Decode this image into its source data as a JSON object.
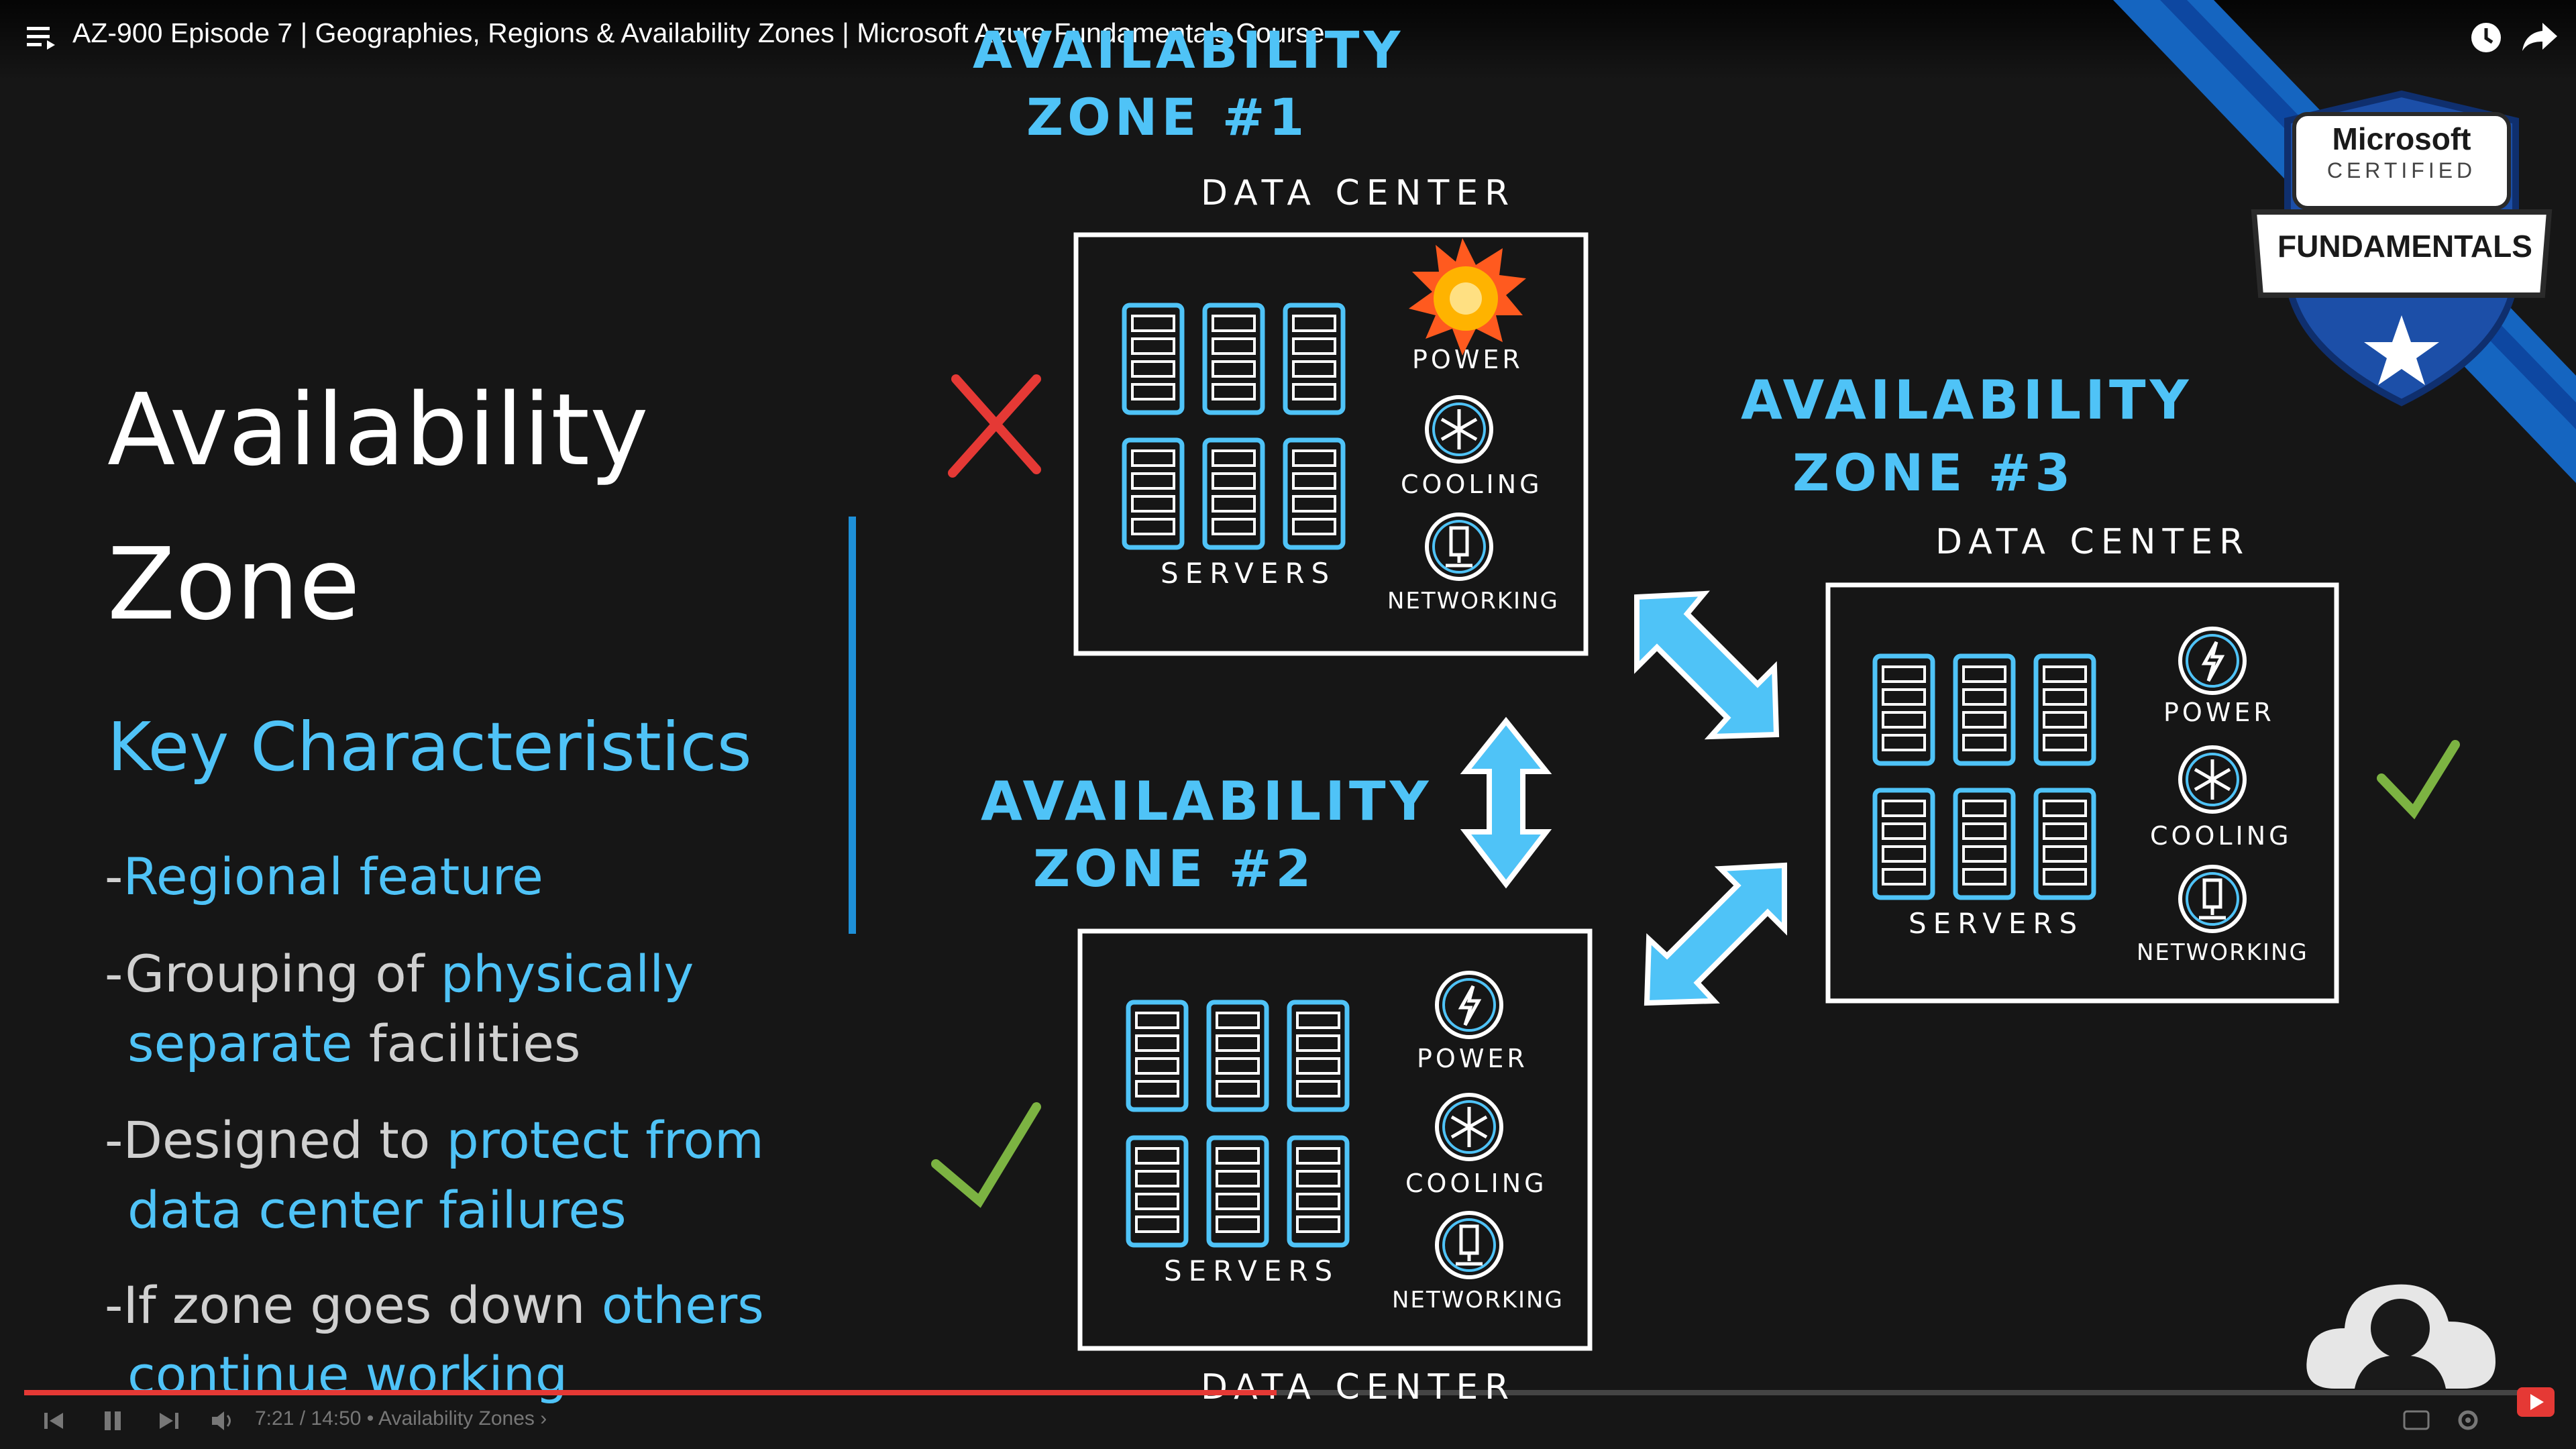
{
  "video": {
    "title": "AZ-900 Episode 7 | Geographies, Regions & Availability Zones | Microsoft Azure Fundamentals Course"
  },
  "badge": {
    "brand": "Microsoft",
    "certified": "CERTIFIED",
    "level": "FUNDAMENTALS"
  },
  "slide": {
    "heading_line1": "Availability",
    "heading_line2": "Zone",
    "subheading": "Key Characteristics",
    "bullets": [
      {
        "dash": "-",
        "parts": [
          "Regional feature"
        ]
      },
      {
        "dash": "-",
        "line1_plain": "Grouping of ",
        "line1_hl": "physically",
        "line2_hl": "separate",
        "line2_plain": " facilities"
      },
      {
        "dash": "-",
        "line1_plain": "Designed to ",
        "line1_hl": "protect from",
        "line2_hl": "data center failures"
      },
      {
        "dash": "-",
        "line1_plain": "If zone goes down ",
        "line1_hl": "others",
        "line2_hl": "continue working"
      }
    ]
  },
  "diagram": {
    "zone1_top": "AVAILABILITY",
    "zone1_bottom": "ZONE  #1",
    "zone2_top": "AVAILABILITY",
    "zone2_bottom": "ZONE  #2",
    "zone3_top": "AVAILABILITY",
    "zone3_bottom": "ZONE  #3",
    "data_center": "DATA CENTER",
    "servers": "SERVERS",
    "power": "POWER",
    "cooling": "COOLING",
    "networking": "NETWORKING"
  },
  "player": {
    "time": "7:21 / 14:50 • Availability Zones ›",
    "progress_fraction": 0.4956
  },
  "colors": {
    "accent": "#4fc3f7",
    "fail": "#e53935",
    "ok": "#7cb342",
    "ribbon": "#1565c0"
  }
}
